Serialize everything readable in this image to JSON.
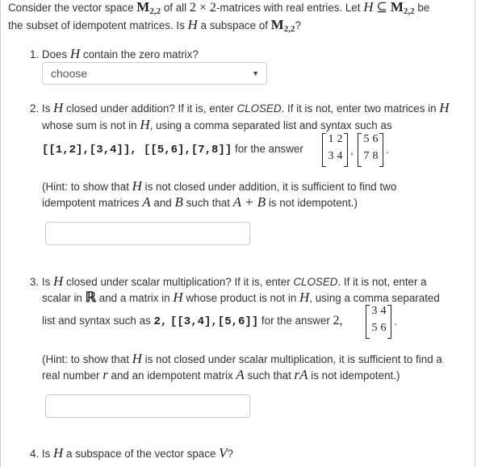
{
  "intro": {
    "t1": "Consider the vector space ",
    "M": "M",
    "M_sub": "2,2",
    "t2": " of all ",
    "dim": "2 × 2",
    "t3": "-matrices with real entries. Let ",
    "H": "H",
    "subset": " ⊆ ",
    "t4": " be",
    "line2_a": "the subset of idempotent matrices. Is ",
    "line2_b": " a subspace of ",
    "line2_c": "?"
  },
  "q1": {
    "num": "1.",
    "a": "Does ",
    "b": " contain the zero matrix?",
    "select_value": "choose"
  },
  "q2": {
    "num": "2.",
    "l1_a": "Is ",
    "l1_b": " closed under addition? If it is, enter ",
    "closed": "CLOSED",
    "l1_c": ". If it is not, enter two matrices in ",
    "l2_a": "whose sum is not in ",
    "l2_b": ", using a comma separated list and syntax such as",
    "code": "[[1,2],[3,4]], [[5,6],[7,8]]",
    "l3_b": " for the answer",
    "mat1": [
      "1",
      "2",
      "3",
      "4"
    ],
    "mat2": [
      "5",
      "6",
      "7",
      "8"
    ],
    "comma": ",",
    "period": ".",
    "hint1_a": "(Hint: to show that ",
    "hint1_b": " is not closed under addition, it is sufficient to find two",
    "hint2_a": "idempotent matrices ",
    "A": "A",
    "hint2_b": " and ",
    "B": "B",
    "hint2_c": " such that ",
    "sum": "A + B",
    "hint2_d": " is not idempotent.)",
    "answer_value": ""
  },
  "q3": {
    "num": "3.",
    "l1_a": "Is ",
    "l1_b": " closed under scalar multiplication? If it is, enter ",
    "closed": "CLOSED",
    "l1_c": ". If it is not, enter a",
    "l2_a": "scalar in ",
    "R": "ℝ",
    "l2_b": " and a matrix in ",
    "l2_c": " whose product is not in ",
    "l2_d": ", using a comma separated",
    "l3_a": "list and syntax such as ",
    "code1": "2,",
    "code2": "[[3,4],[5,6]]",
    "l3_b": " for the answer ",
    "scalar": "2,",
    "mat": [
      "3",
      "4",
      "5",
      "6"
    ],
    "period": ".",
    "hint1_a": "(Hint: to show that ",
    "hint1_b": " is not closed under scalar multiplication, it is sufficient to find a",
    "hint2_a": "real number ",
    "r": "r",
    "hint2_b": " and an idempotent matrix ",
    "A": "A",
    "hint2_c": " such that ",
    "rA": "rA",
    "hint2_d": " is not idempotent.)",
    "answer_value": ""
  },
  "q4": {
    "num": "4.",
    "a": "Is ",
    "b": " a subspace of the vector space ",
    "V": "V",
    "c": "?"
  }
}
